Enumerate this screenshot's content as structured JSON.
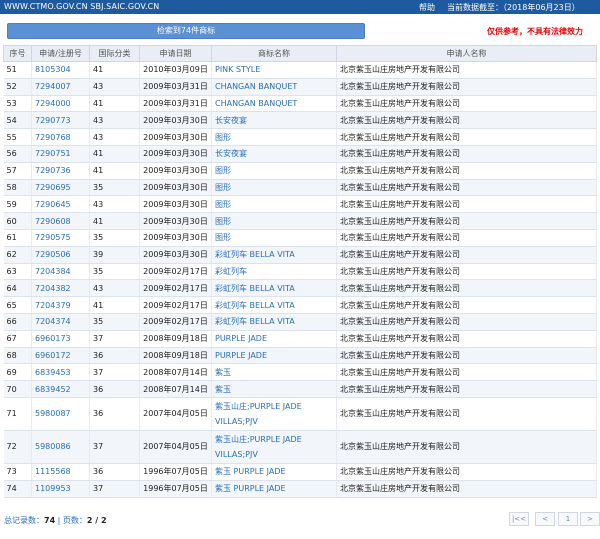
{
  "topbar": {
    "site": "WWW.CTMO.GOV.CN SBJ.SAIC.GOV.CN",
    "help": "帮助",
    "date_label": "当前数据截至：",
    "date_value": "（2018年06月23日）"
  },
  "search_button": "检索到74件商标",
  "disclaimer": "仅供参考，不具有法律效力",
  "table": {
    "headers": [
      "序号",
      "申请/注册号",
      "国际分类",
      "申请日期",
      "商标名称",
      "申请人名称"
    ],
    "rows": [
      [
        "51",
        "8105304",
        "41",
        "2010年03月09日",
        "PINK STYLE",
        "北京紫玉山庄房地产开发有限公司"
      ],
      [
        "52",
        "7294007",
        "43",
        "2009年03月31日",
        "CHANGAN BANQUET",
        "北京紫玉山庄房地产开发有限公司"
      ],
      [
        "53",
        "7294000",
        "41",
        "2009年03月31日",
        "CHANGAN BANQUET",
        "北京紫玉山庄房地产开发有限公司"
      ],
      [
        "54",
        "7290773",
        "43",
        "2009年03月30日",
        "长安夜宴",
        "北京紫玉山庄房地产开发有限公司"
      ],
      [
        "55",
        "7290768",
        "43",
        "2009年03月30日",
        "图形",
        "北京紫玉山庄房地产开发有限公司"
      ],
      [
        "56",
        "7290751",
        "41",
        "2009年03月30日",
        "长安夜宴",
        "北京紫玉山庄房地产开发有限公司"
      ],
      [
        "57",
        "7290736",
        "41",
        "2009年03月30日",
        "图形",
        "北京紫玉山庄房地产开发有限公司"
      ],
      [
        "58",
        "7290695",
        "35",
        "2009年03月30日",
        "图形",
        "北京紫玉山庄房地产开发有限公司"
      ],
      [
        "59",
        "7290645",
        "43",
        "2009年03月30日",
        "图形",
        "北京紫玉山庄房地产开发有限公司"
      ],
      [
        "60",
        "7290608",
        "41",
        "2009年03月30日",
        "图形",
        "北京紫玉山庄房地产开发有限公司"
      ],
      [
        "61",
        "7290575",
        "35",
        "2009年03月30日",
        "图形",
        "北京紫玉山庄房地产开发有限公司"
      ],
      [
        "62",
        "7290506",
        "39",
        "2009年03月30日",
        "彩虹列车 BELLA VITA",
        "北京紫玉山庄房地产开发有限公司"
      ],
      [
        "63",
        "7204384",
        "35",
        "2009年02月17日",
        "彩虹列车",
        "北京紫玉山庄房地产开发有限公司"
      ],
      [
        "64",
        "7204382",
        "43",
        "2009年02月17日",
        "彩虹列车 BELLA VITA",
        "北京紫玉山庄房地产开发有限公司"
      ],
      [
        "65",
        "7204379",
        "41",
        "2009年02月17日",
        "彩虹列车 BELLA VITA",
        "北京紫玉山庄房地产开发有限公司"
      ],
      [
        "66",
        "7204374",
        "35",
        "2009年02月17日",
        "彩虹列车 BELLA VITA",
        "北京紫玉山庄房地产开发有限公司"
      ],
      [
        "67",
        "6960173",
        "37",
        "2008年09月18日",
        "PURPLE JADE",
        "北京紫玉山庄房地产开发有限公司"
      ],
      [
        "68",
        "6960172",
        "36",
        "2008年09月18日",
        "PURPLE JADE",
        "北京紫玉山庄房地产开发有限公司"
      ],
      [
        "69",
        "6839453",
        "37",
        "2008年07月14日",
        "紫玉",
        "北京紫玉山庄房地产开发有限公司"
      ],
      [
        "70",
        "6839452",
        "36",
        "2008年07月14日",
        "紫玉",
        "北京紫玉山庄房地产开发有限公司"
      ],
      [
        "71",
        "5980087",
        "36",
        "2007年04月05日",
        "紫玉山庄;PURPLE JADE VILLAS;PJV",
        "北京紫玉山庄房地产开发有限公司"
      ],
      [
        "72",
        "5980086",
        "37",
        "2007年04月05日",
        "紫玉山庄;PURPLE JADE VILLAS;PJV",
        "北京紫玉山庄房地产开发有限公司"
      ],
      [
        "73",
        "1115568",
        "36",
        "1996年07月05日",
        "紫玉 PURPLE JADE",
        "北京紫玉山庄房地产开发有限公司"
      ],
      [
        "74",
        "1109953",
        "37",
        "1996年07月05日",
        "紫玉 PURPLE JADE",
        "北京紫玉山庄房地产开发有限公司"
      ]
    ]
  },
  "summary": {
    "total_label": "总记录数：",
    "total_value": "74",
    "sep": " | 页数：",
    "pages_value": "2 / 2"
  },
  "pager": {
    "first": "|<<",
    "prev": "<",
    "current": "1",
    "next": ">"
  }
}
